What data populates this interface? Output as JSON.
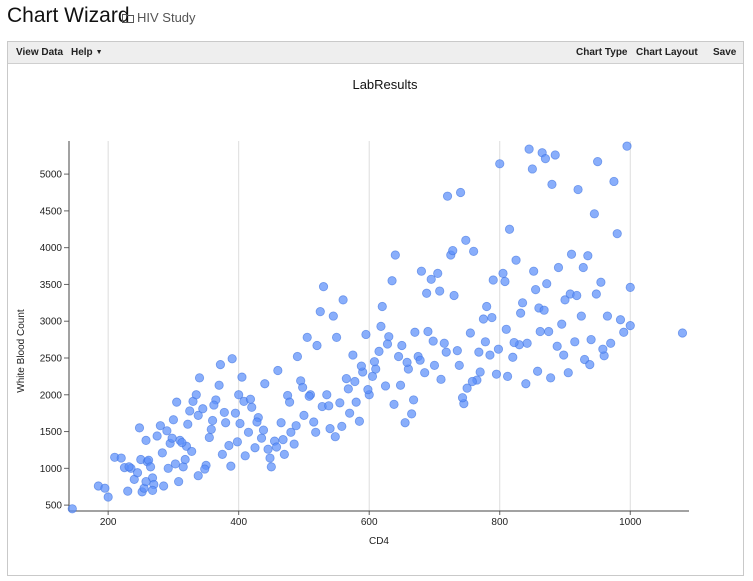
{
  "header": {
    "title": "Chart Wizard",
    "folder_label": "HIV Study"
  },
  "toolbar": {
    "view_data": "View Data",
    "help": "Help",
    "chart_type": "Chart Type",
    "chart_layout": "Chart Layout",
    "save": "Save"
  },
  "colors": {
    "point_fill": "#5b8ff9",
    "point_stroke": "#3b6fe0",
    "grid": "#dddddd"
  },
  "chart_data": {
    "type": "scatter",
    "title": "LabResults",
    "xlabel": "CD4",
    "ylabel": "White Blood Count",
    "xlim": [
      140,
      1090
    ],
    "ylim": [
      420,
      5450
    ],
    "xticks": [
      "200",
      "400",
      "600",
      "800",
      "1000"
    ],
    "yticks": [
      "500",
      "1000",
      "1500",
      "2000",
      "2500",
      "3000",
      "3500",
      "4000",
      "4500",
      "5000"
    ],
    "grid": true,
    "series": [
      {
        "points": [
          [
            145,
            450
          ],
          [
            185,
            760
          ],
          [
            195,
            730
          ],
          [
            200,
            610
          ],
          [
            210,
            1150
          ],
          [
            220,
            1140
          ],
          [
            225,
            1010
          ],
          [
            230,
            690
          ],
          [
            235,
            1000
          ],
          [
            240,
            850
          ],
          [
            245,
            940
          ],
          [
            248,
            1550
          ],
          [
            250,
            1120
          ],
          [
            252,
            680
          ],
          [
            255,
            730
          ],
          [
            258,
            1380
          ],
          [
            260,
            1090
          ],
          [
            262,
            1110
          ],
          [
            265,
            1020
          ],
          [
            268,
            870
          ],
          [
            270,
            780
          ],
          [
            275,
            1440
          ],
          [
            280,
            1580
          ],
          [
            285,
            760
          ],
          [
            290,
            1510
          ],
          [
            295,
            1340
          ],
          [
            300,
            1660
          ],
          [
            305,
            1900
          ],
          [
            310,
            1380
          ],
          [
            315,
            1020
          ],
          [
            320,
            1300
          ],
          [
            322,
            1600
          ],
          [
            325,
            1780
          ],
          [
            330,
            1910
          ],
          [
            335,
            2000
          ],
          [
            338,
            1720
          ],
          [
            340,
            2230
          ],
          [
            345,
            1810
          ],
          [
            350,
            1040
          ],
          [
            355,
            1420
          ],
          [
            360,
            1650
          ],
          [
            365,
            1930
          ],
          [
            370,
            2130
          ],
          [
            372,
            2410
          ],
          [
            375,
            1190
          ],
          [
            380,
            1620
          ],
          [
            385,
            1310
          ],
          [
            390,
            2490
          ],
          [
            395,
            1750
          ],
          [
            400,
            2000
          ],
          [
            405,
            2240
          ],
          [
            410,
            1170
          ],
          [
            415,
            1490
          ],
          [
            420,
            1830
          ],
          [
            425,
            1280
          ],
          [
            430,
            1690
          ],
          [
            435,
            1410
          ],
          [
            440,
            2150
          ],
          [
            445,
            1260
          ],
          [
            450,
            1020
          ],
          [
            455,
            1370
          ],
          [
            460,
            2330
          ],
          [
            465,
            1620
          ],
          [
            470,
            1190
          ],
          [
            475,
            1990
          ],
          [
            480,
            1490
          ],
          [
            485,
            1330
          ],
          [
            490,
            2520
          ],
          [
            495,
            2190
          ],
          [
            500,
            1720
          ],
          [
            505,
            2780
          ],
          [
            510,
            2000
          ],
          [
            515,
            1630
          ],
          [
            520,
            2670
          ],
          [
            525,
            3130
          ],
          [
            530,
            3470
          ],
          [
            535,
            2000
          ],
          [
            540,
            1540
          ],
          [
            545,
            3070
          ],
          [
            550,
            2780
          ],
          [
            555,
            1890
          ],
          [
            560,
            3290
          ],
          [
            565,
            2220
          ],
          [
            570,
            1750
          ],
          [
            575,
            2540
          ],
          [
            580,
            1900
          ],
          [
            585,
            1640
          ],
          [
            590,
            2310
          ],
          [
            595,
            2820
          ],
          [
            600,
            2000
          ],
          [
            605,
            2250
          ],
          [
            610,
            2350
          ],
          [
            615,
            2590
          ],
          [
            620,
            3200
          ],
          [
            625,
            2120
          ],
          [
            630,
            2790
          ],
          [
            635,
            3550
          ],
          [
            640,
            3900
          ],
          [
            645,
            2520
          ],
          [
            650,
            2670
          ],
          [
            655,
            1620
          ],
          [
            660,
            2350
          ],
          [
            665,
            1740
          ],
          [
            670,
            2850
          ],
          [
            675,
            2520
          ],
          [
            680,
            3680
          ],
          [
            685,
            2300
          ],
          [
            690,
            2860
          ],
          [
            695,
            3570
          ],
          [
            700,
            2400
          ],
          [
            705,
            3650
          ],
          [
            710,
            2210
          ],
          [
            715,
            2700
          ],
          [
            720,
            4700
          ],
          [
            725,
            3900
          ],
          [
            730,
            3350
          ],
          [
            735,
            2600
          ],
          [
            740,
            4750
          ],
          [
            745,
            1880
          ],
          [
            748,
            4100
          ],
          [
            750,
            2090
          ],
          [
            755,
            2840
          ],
          [
            760,
            3950
          ],
          [
            765,
            2200
          ],
          [
            770,
            2310
          ],
          [
            775,
            3030
          ],
          [
            780,
            3200
          ],
          [
            785,
            2540
          ],
          [
            790,
            3560
          ],
          [
            795,
            2280
          ],
          [
            800,
            5140
          ],
          [
            805,
            3650
          ],
          [
            810,
            2890
          ],
          [
            815,
            4250
          ],
          [
            820,
            2510
          ],
          [
            825,
            3830
          ],
          [
            830,
            2680
          ],
          [
            835,
            3250
          ],
          [
            840,
            2150
          ],
          [
            845,
            5340
          ],
          [
            850,
            5070
          ],
          [
            855,
            3430
          ],
          [
            860,
            3180
          ],
          [
            865,
            5290
          ],
          [
            870,
            5210
          ],
          [
            875,
            2860
          ],
          [
            880,
            4860
          ],
          [
            885,
            5260
          ],
          [
            890,
            3730
          ],
          [
            895,
            2960
          ],
          [
            900,
            3290
          ],
          [
            905,
            2300
          ],
          [
            910,
            3910
          ],
          [
            915,
            2720
          ],
          [
            920,
            4790
          ],
          [
            925,
            3070
          ],
          [
            930,
            2480
          ],
          [
            935,
            3890
          ],
          [
            940,
            2750
          ],
          [
            945,
            4460
          ],
          [
            950,
            5170
          ],
          [
            955,
            3530
          ],
          [
            960,
            2530
          ],
          [
            965,
            3070
          ],
          [
            970,
            2700
          ],
          [
            975,
            4900
          ],
          [
            980,
            4190
          ],
          [
            985,
            3020
          ],
          [
            990,
            2850
          ],
          [
            995,
            5380
          ],
          [
            1000,
            3460
          ],
          [
            1000,
            2940
          ],
          [
            1080,
            2840
          ],
          [
            232,
            1020
          ],
          [
            258,
            820
          ],
          [
            268,
            700
          ],
          [
            283,
            1210
          ],
          [
            292,
            1000
          ],
          [
            298,
            1410
          ],
          [
            303,
            1060
          ],
          [
            308,
            820
          ],
          [
            313,
            1350
          ],
          [
            318,
            1120
          ],
          [
            328,
            1230
          ],
          [
            338,
            900
          ],
          [
            348,
            990
          ],
          [
            358,
            1530
          ],
          [
            362,
            1860
          ],
          [
            378,
            1760
          ],
          [
            388,
            1030
          ],
          [
            398,
            1360
          ],
          [
            402,
            1610
          ],
          [
            408,
            1910
          ],
          [
            418,
            1940
          ],
          [
            428,
            1630
          ],
          [
            438,
            1520
          ],
          [
            448,
            1140
          ],
          [
            458,
            1290
          ],
          [
            468,
            1390
          ],
          [
            478,
            1900
          ],
          [
            488,
            1580
          ],
          [
            498,
            2100
          ],
          [
            508,
            1980
          ],
          [
            518,
            1490
          ],
          [
            528,
            1840
          ],
          [
            538,
            1850
          ],
          [
            548,
            1430
          ],
          [
            558,
            1570
          ],
          [
            568,
            2080
          ],
          [
            578,
            2180
          ],
          [
            588,
            2390
          ],
          [
            598,
            2070
          ],
          [
            608,
            2450
          ],
          [
            618,
            2930
          ],
          [
            628,
            2690
          ],
          [
            638,
            1870
          ],
          [
            648,
            2130
          ],
          [
            658,
            2440
          ],
          [
            668,
            1930
          ],
          [
            678,
            2470
          ],
          [
            688,
            3380
          ],
          [
            698,
            2730
          ],
          [
            708,
            3410
          ],
          [
            718,
            2580
          ],
          [
            728,
            3960
          ],
          [
            738,
            2400
          ],
          [
            743,
            1960
          ],
          [
            758,
            2180
          ],
          [
            768,
            2580
          ],
          [
            778,
            2720
          ],
          [
            788,
            3050
          ],
          [
            798,
            2620
          ],
          [
            808,
            3540
          ],
          [
            812,
            2250
          ],
          [
            822,
            2710
          ],
          [
            832,
            3110
          ],
          [
            842,
            2700
          ],
          [
            852,
            3680
          ],
          [
            858,
            2320
          ],
          [
            862,
            2860
          ],
          [
            868,
            3150
          ],
          [
            872,
            3510
          ],
          [
            878,
            2230
          ],
          [
            888,
            2660
          ],
          [
            898,
            2540
          ],
          [
            908,
            3370
          ],
          [
            918,
            3350
          ],
          [
            928,
            3730
          ],
          [
            938,
            2410
          ],
          [
            948,
            3370
          ],
          [
            958,
            2620
          ]
        ]
      }
    ]
  }
}
